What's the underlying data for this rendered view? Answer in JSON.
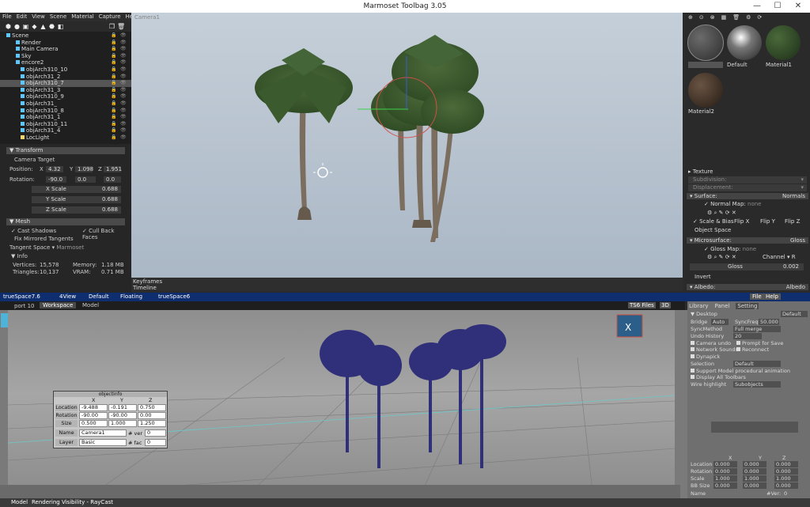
{
  "window": {
    "title": "Marmoset Toolbag 3.05",
    "min": "—",
    "max": "☐",
    "close": "✕"
  },
  "menu": [
    "File",
    "Edit",
    "View",
    "Scene",
    "Material",
    "Capture",
    "Help"
  ],
  "scene_items": [
    {
      "label": "Scene",
      "indent": 8,
      "icon": "cube"
    },
    {
      "label": "Render",
      "indent": 20,
      "icon": "cube"
    },
    {
      "label": "Main Camera",
      "indent": 20,
      "icon": "cube"
    },
    {
      "label": "Sky",
      "indent": 20,
      "icon": "cube"
    },
    {
      "label": "encore2",
      "indent": 20,
      "icon": "cube"
    },
    {
      "label": "objArch310_10",
      "indent": 26,
      "icon": "cube"
    },
    {
      "label": "objArch31_2",
      "indent": 26,
      "icon": "cube"
    },
    {
      "label": "objArch310_7",
      "indent": 26,
      "icon": "cube",
      "selected": true
    },
    {
      "label": "objArch31_3",
      "indent": 26,
      "icon": "cube"
    },
    {
      "label": "objArch310_9",
      "indent": 26,
      "icon": "cube"
    },
    {
      "label": "objArch31_",
      "indent": 26,
      "icon": "cube"
    },
    {
      "label": "objArch310_8",
      "indent": 26,
      "icon": "cube"
    },
    {
      "label": "objArch31_1",
      "indent": 26,
      "icon": "cube"
    },
    {
      "label": "objArch310_11",
      "indent": 26,
      "icon": "cube"
    },
    {
      "label": "objArch31_4",
      "indent": 26,
      "icon": "cube"
    },
    {
      "label": "LocLight",
      "indent": 26,
      "icon": "bulb"
    }
  ],
  "transform": {
    "header": "Transform",
    "camera_target": "Camera Target",
    "position_label": "Position:",
    "rotation_label": "Rotation:",
    "x": "X",
    "y": "Y",
    "z": "Z",
    "pos": [
      "4.32",
      "1.098",
      "1.951"
    ],
    "rot": [
      "-90.0",
      "0.0",
      "0.0"
    ],
    "xscale_label": "X Scale",
    "xscale": "0.688",
    "yscale_label": "Y Scale",
    "yscale": "0.688",
    "zscale_label": "Z Scale",
    "zscale": "0.688"
  },
  "mesh": {
    "header": "Mesh",
    "cast_shadows": "Cast Shadows",
    "cull_back": "Cull Back Faces",
    "fix_mirrored": "Fix Mirrored Tangents",
    "tangent_label": "Tangent Space",
    "tangent_value": "Marmoset",
    "info_header": "Info",
    "vertices_label": "Vertices:",
    "vertices": "15,578",
    "triangles_label": "Triangles:",
    "triangles": "10,137",
    "memory_label": "Memory:",
    "memory": "1.18 MB",
    "vram_label": "VRAM:",
    "vram": "0.71 MB"
  },
  "viewport1": {
    "camera_label": "Camera1"
  },
  "timeline": {
    "keyframes": "Keyframes",
    "timeline": "Timeline"
  },
  "materials": {
    "names": [
      "",
      "Default",
      "Material1",
      "Material2"
    ]
  },
  "material_panel": {
    "texture": "Texture",
    "subdivision": "Subdivision:",
    "displacement": "Displacement:",
    "surface": "Surface:",
    "surface_val": "Normals",
    "normal_map": "Normal Map:",
    "normal_map_val": "none",
    "scale_bias": "Scale & Bias",
    "flip_x": "Flip X",
    "flip_y": "Flip Y",
    "flip_z": "Flip Z",
    "object_space": "Object Space",
    "microsurface": "Microsurface:",
    "micro_val": "Gloss",
    "gloss_map": "Gloss Map:",
    "gloss_map_val": "none",
    "channel": "Channel",
    "channel_val": "R",
    "gloss": "Gloss",
    "gloss_val": "0.002",
    "invert": "Invert",
    "albedo": "Albedo:",
    "albedo_val": "Albedo"
  },
  "ts": {
    "title": "trueSpace7.6",
    "tabs": [
      "4View",
      "Default",
      "Floating",
      "trueSpace6"
    ],
    "file": "File",
    "help": "Help",
    "port": "port 10",
    "ws_tab": "Workspace",
    "model_tab": "Model",
    "ts6_files": "TS6 Files",
    "mode_3d": "3D"
  },
  "objinfo": {
    "title": "objectInfo",
    "cols": [
      "X",
      "Y",
      "Z"
    ],
    "rows": [
      {
        "label": "Location",
        "v": [
          "-9.488",
          "-0.191",
          "0.750"
        ]
      },
      {
        "label": "Rotation",
        "v": [
          "-90.00",
          "-90.00",
          "0.00"
        ]
      },
      {
        "label": "Size",
        "v": [
          "0.500",
          "1.000",
          "1.250"
        ]
      }
    ],
    "name_label": "Name",
    "name": "Camera1",
    "ver_label": "# ver",
    "ver": "0",
    "layer_label": "Layer",
    "layer": "Basic",
    "fac_label": "# fac",
    "fac": "0"
  },
  "ts_panel": {
    "tabs": [
      "Library",
      "Panel",
      "Setting"
    ],
    "desktop": "Desktop",
    "desktop_val": "Default",
    "bridge": "Bridge",
    "auto": "Auto",
    "syncfreq": "SyncFreq",
    "syncfreq_val": "50.000",
    "syncmethod": "SyncMethod",
    "syncmethod_val": "Full merge",
    "undo_history": "Undo History",
    "undo_val": "20",
    "camera_undo": "Camera undo",
    "prompt_save": "Prompt for Save",
    "network_sounds": "Network Sounds",
    "reconnect": "Reconnect",
    "dynapick": "Dynapick",
    "selection": "Selection",
    "selection_val": "Default",
    "support_proc": "Support Model procedural animation",
    "display_toolbars": "Display All Toolbars",
    "wire_highlight": "Wire highlight",
    "wire_val": "Subobjects",
    "cols": [
      "X",
      "Y",
      "Z"
    ],
    "rows": [
      {
        "label": "Location",
        "v": [
          "0.000",
          "0.000",
          "0.000"
        ]
      },
      {
        "label": "Rotation",
        "v": [
          "0.000",
          "0.000",
          "0.000"
        ]
      },
      {
        "label": "Scale",
        "v": [
          "1.000",
          "1.000",
          "1.000"
        ]
      },
      {
        "label": "BB Size",
        "v": [
          "0.000",
          "0.000",
          "0.000"
        ]
      }
    ],
    "name_label": "Name",
    "ver_label": "#Ver:",
    "ver": "0"
  },
  "status": {
    "model": "Model",
    "text": "Rendering Visibility - RayCast"
  }
}
